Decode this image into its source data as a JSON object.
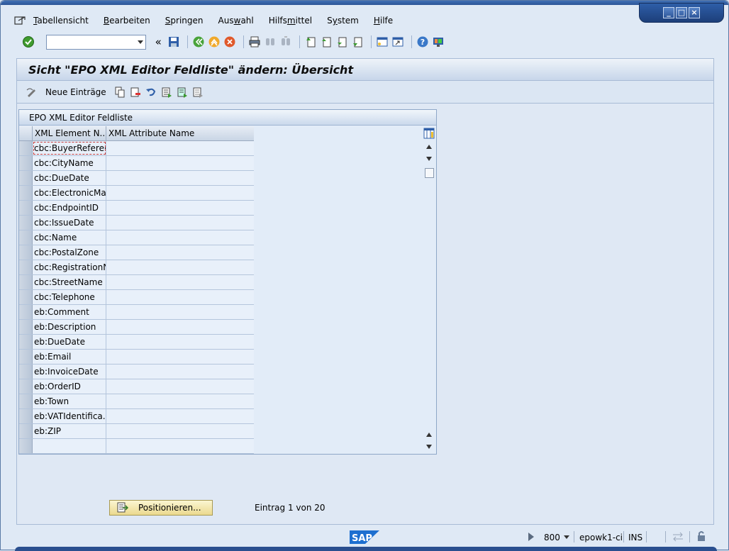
{
  "window": {
    "controls": {
      "minimize": "_",
      "maximize": "□",
      "close": "×"
    }
  },
  "menubar": {
    "items": [
      {
        "label": "Tabellensicht",
        "underline": "T"
      },
      {
        "label": "Bearbeiten",
        "underline": "B"
      },
      {
        "label": "Springen",
        "underline": "S"
      },
      {
        "label": "Auswahl",
        "underline": "w"
      },
      {
        "label": "Hilfsmittel",
        "underline": "m"
      },
      {
        "label": "System",
        "underline": "y"
      },
      {
        "label": "Hilfe",
        "underline": "H"
      }
    ]
  },
  "toolbar": {
    "command_value": "",
    "collapse_glyph": "«"
  },
  "title": "Sicht \"EPO XML Editor Feldliste\" ändern: Übersicht",
  "apptoolbar": {
    "new_entries_label": "Neue Einträge"
  },
  "table": {
    "title": "EPO XML Editor Feldliste",
    "headers": [
      "XML Element N...",
      "XML Attribute Name"
    ],
    "rows": [
      [
        "cbc:BuyerReference",
        ""
      ],
      [
        "cbc:CityName",
        ""
      ],
      [
        "cbc:DueDate",
        ""
      ],
      [
        "cbc:ElectronicMail",
        ""
      ],
      [
        "cbc:EndpointID",
        ""
      ],
      [
        "cbc:IssueDate",
        ""
      ],
      [
        "cbc:Name",
        ""
      ],
      [
        "cbc:PostalZone",
        ""
      ],
      [
        "cbc:RegistrationN...",
        ""
      ],
      [
        "cbc:StreetName",
        ""
      ],
      [
        "cbc:Telephone",
        ""
      ],
      [
        "eb:Comment",
        ""
      ],
      [
        "eb:Description",
        ""
      ],
      [
        "eb:DueDate",
        ""
      ],
      [
        "eb:Email",
        ""
      ],
      [
        "eb:InvoiceDate",
        ""
      ],
      [
        "eb:OrderID",
        ""
      ],
      [
        "eb:Town",
        ""
      ],
      [
        "eb:VATIdentifica...",
        ""
      ],
      [
        "eb:ZIP",
        ""
      ],
      [
        "",
        ""
      ]
    ]
  },
  "footer": {
    "position_button": "Positionieren...",
    "entry_text": "Eintrag 1 von 20"
  },
  "statusbar": {
    "client": "800",
    "server": "epowk1-ci",
    "mode": "INS",
    "logo": "SAP"
  }
}
